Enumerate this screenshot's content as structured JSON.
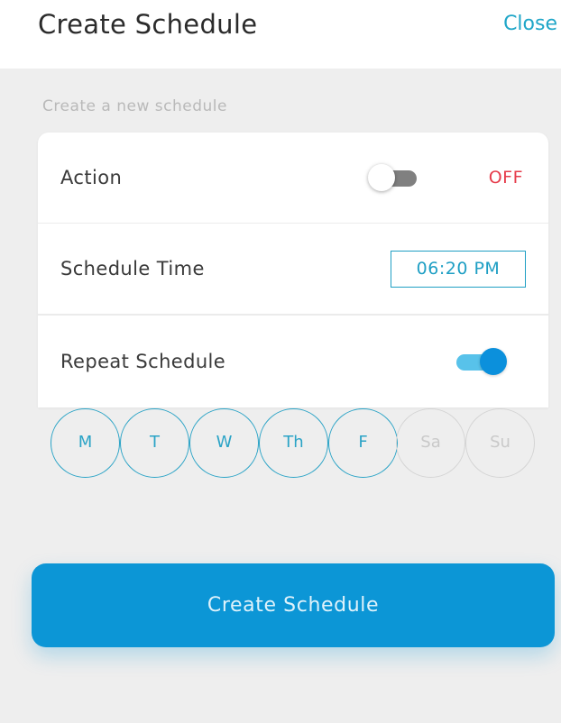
{
  "header": {
    "title": "Create Schedule",
    "close_label": "Close"
  },
  "subtitle": "Create a new schedule",
  "rows": {
    "action": {
      "label": "Action",
      "toggle_on": false,
      "state_text": "OFF"
    },
    "schedule_time": {
      "label": "Schedule Time",
      "value": "06:20 PM"
    },
    "repeat": {
      "label": "Repeat Schedule",
      "toggle_on": true
    }
  },
  "days": [
    {
      "label": "M",
      "selected": true
    },
    {
      "label": "T",
      "selected": true
    },
    {
      "label": "W",
      "selected": true
    },
    {
      "label": "Th",
      "selected": true
    },
    {
      "label": "F",
      "selected": true
    },
    {
      "label": "Sa",
      "selected": false
    },
    {
      "label": "Su",
      "selected": false
    }
  ],
  "create_button_label": "Create Schedule",
  "colors": {
    "accent": "#1fa6c8",
    "primary_button": "#0c96d6",
    "off_state": "#e63c4b",
    "toggle_on_knob": "#0b90dc",
    "toggle_on_track": "#58c2ea",
    "day_inactive": "#d4d4d4"
  }
}
